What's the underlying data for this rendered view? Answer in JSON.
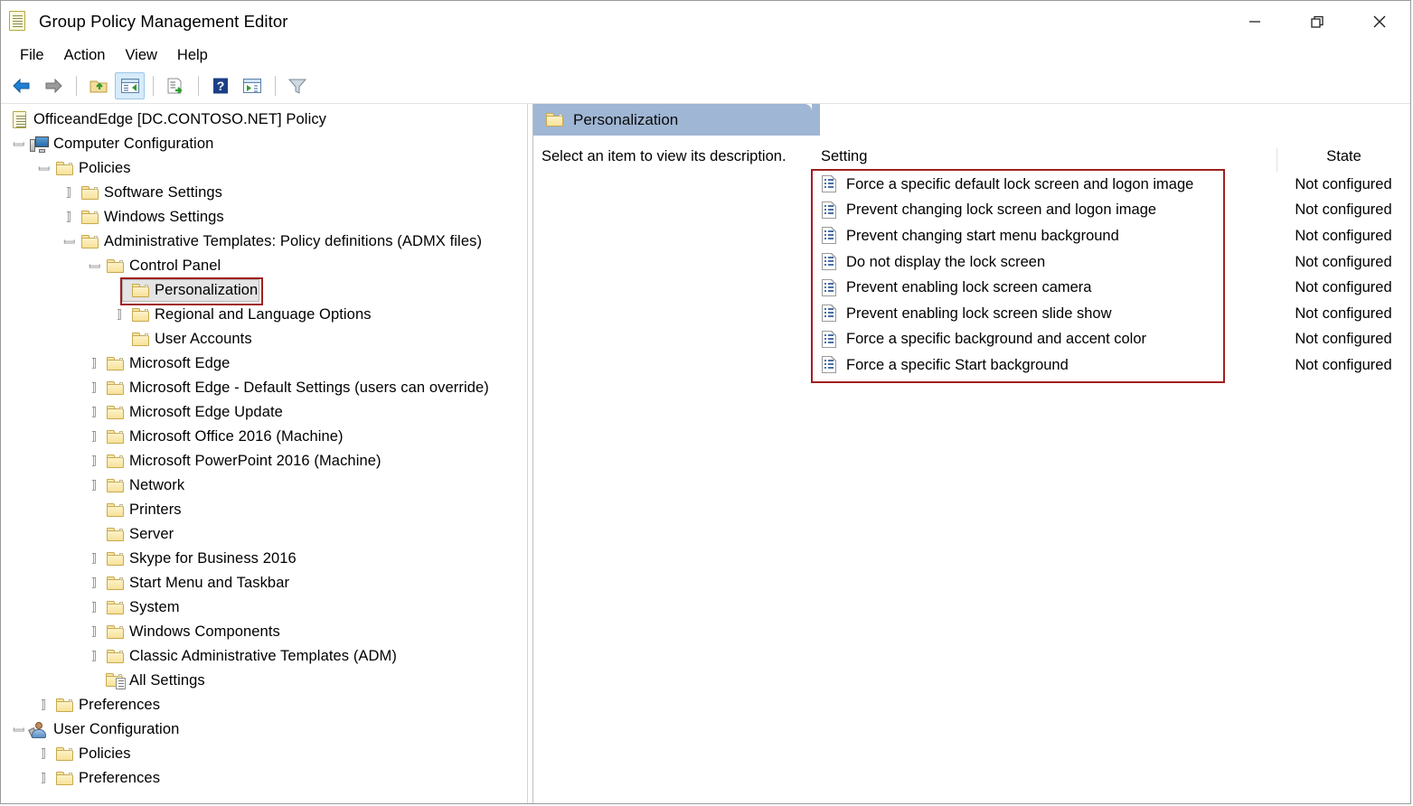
{
  "window": {
    "title": "Group Policy Management Editor",
    "title_icon": "policy-document-icon",
    "controls": {
      "minimize": "minimize",
      "restore": "restore",
      "close": "close"
    }
  },
  "menu": {
    "items": [
      {
        "label": "File"
      },
      {
        "label": "Action"
      },
      {
        "label": "View"
      },
      {
        "label": "Help"
      }
    ]
  },
  "toolbar": {
    "buttons": [
      {
        "name": "back-arrow-icon",
        "active": false
      },
      {
        "name": "forward-arrow-icon",
        "active": false
      },
      {
        "name": "up-one-level-icon",
        "active": false
      },
      {
        "name": "show-hide-tree-icon",
        "active": true
      },
      {
        "name": "export-list-icon",
        "active": false
      },
      {
        "name": "help-icon",
        "active": false
      },
      {
        "name": "properties-icon",
        "active": false
      },
      {
        "name": "filter-icon",
        "active": false
      }
    ]
  },
  "tree": {
    "root": {
      "label": "OfficeandEdge [DC.CONTOSO.NET] Policy",
      "icon": "policy-document-icon"
    },
    "nodes": [
      {
        "label": "Computer Configuration",
        "icon": "computer-icon",
        "indent": 0,
        "twist": "down",
        "selected": false
      },
      {
        "label": "Policies",
        "icon": "folder-icon",
        "indent": 1,
        "twist": "down",
        "selected": false
      },
      {
        "label": "Software Settings",
        "icon": "folder-icon",
        "indent": 2,
        "twist": "right",
        "selected": false
      },
      {
        "label": "Windows Settings",
        "icon": "folder-icon",
        "indent": 2,
        "twist": "right",
        "selected": false
      },
      {
        "label": "Administrative Templates: Policy definitions (ADMX files)",
        "icon": "folder-icon",
        "indent": 2,
        "twist": "down",
        "selected": false
      },
      {
        "label": "Control Panel",
        "icon": "folder-icon",
        "indent": 3,
        "twist": "down",
        "selected": false
      },
      {
        "label": "Personalization",
        "icon": "folder-icon",
        "indent": 4,
        "twist": "none",
        "selected": true
      },
      {
        "label": "Regional and Language Options",
        "icon": "folder-icon",
        "indent": 4,
        "twist": "right",
        "selected": false
      },
      {
        "label": "User Accounts",
        "icon": "folder-icon",
        "indent": 4,
        "twist": "none",
        "selected": false
      },
      {
        "label": "Microsoft Edge",
        "icon": "folder-icon",
        "indent": 3,
        "twist": "right",
        "selected": false
      },
      {
        "label": "Microsoft Edge - Default Settings (users can override)",
        "icon": "folder-icon",
        "indent": 3,
        "twist": "right",
        "selected": false
      },
      {
        "label": "Microsoft Edge Update",
        "icon": "folder-icon",
        "indent": 3,
        "twist": "right",
        "selected": false
      },
      {
        "label": "Microsoft Office 2016 (Machine)",
        "icon": "folder-icon",
        "indent": 3,
        "twist": "right",
        "selected": false
      },
      {
        "label": "Microsoft PowerPoint 2016 (Machine)",
        "icon": "folder-icon",
        "indent": 3,
        "twist": "right",
        "selected": false
      },
      {
        "label": "Network",
        "icon": "folder-icon",
        "indent": 3,
        "twist": "right",
        "selected": false
      },
      {
        "label": "Printers",
        "icon": "folder-icon",
        "indent": 3,
        "twist": "none",
        "selected": false
      },
      {
        "label": "Server",
        "icon": "folder-icon",
        "indent": 3,
        "twist": "none",
        "selected": false
      },
      {
        "label": "Skype for Business 2016",
        "icon": "folder-icon",
        "indent": 3,
        "twist": "right",
        "selected": false
      },
      {
        "label": "Start Menu and Taskbar",
        "icon": "folder-icon",
        "indent": 3,
        "twist": "right",
        "selected": false
      },
      {
        "label": "System",
        "icon": "folder-icon",
        "indent": 3,
        "twist": "right",
        "selected": false
      },
      {
        "label": "Windows Components",
        "icon": "folder-icon",
        "indent": 3,
        "twist": "right",
        "selected": false
      },
      {
        "label": "Classic Administrative Templates (ADM)",
        "icon": "folder-icon",
        "indent": 3,
        "twist": "right",
        "selected": false
      },
      {
        "label": "All Settings",
        "icon": "all-settings-icon",
        "indent": 3,
        "twist": "none",
        "selected": false
      },
      {
        "label": "Preferences",
        "icon": "folder-icon",
        "indent": 1,
        "twist": "right",
        "selected": false
      },
      {
        "label": "User Configuration",
        "icon": "user-icon",
        "indent": 0,
        "twist": "down",
        "selected": false
      },
      {
        "label": "Policies",
        "icon": "folder-icon",
        "indent": 1,
        "twist": "right",
        "selected": false
      },
      {
        "label": "Preferences",
        "icon": "folder-icon",
        "indent": 1,
        "twist": "right",
        "selected": false
      }
    ]
  },
  "detail": {
    "header": {
      "title": "Personalization",
      "icon": "folder-icon"
    },
    "description": "Select an item to view its description.",
    "columns": {
      "setting": "Setting",
      "state": "State"
    },
    "settings": [
      {
        "name": "Force a specific default lock screen and logon image",
        "state": "Not configured"
      },
      {
        "name": "Prevent changing lock screen and logon image",
        "state": "Not configured"
      },
      {
        "name": "Prevent changing start menu background",
        "state": "Not configured"
      },
      {
        "name": "Do not display the lock screen",
        "state": "Not configured"
      },
      {
        "name": "Prevent enabling lock screen camera",
        "state": "Not configured"
      },
      {
        "name": "Prevent enabling lock screen slide show",
        "state": "Not configured"
      },
      {
        "name": "Force a specific background and accent color",
        "state": "Not configured"
      },
      {
        "name": "Force a specific Start background",
        "state": "Not configured"
      }
    ]
  },
  "annotations": {
    "highlight_color": "#a02020",
    "boxes": [
      {
        "target": "tree-item-personalization"
      },
      {
        "target": "settings-list"
      }
    ]
  },
  "colors": {
    "header_band": "#9fb6d4",
    "selection": "#e4e4e4",
    "toolbar_active": "#d6ebfb"
  }
}
